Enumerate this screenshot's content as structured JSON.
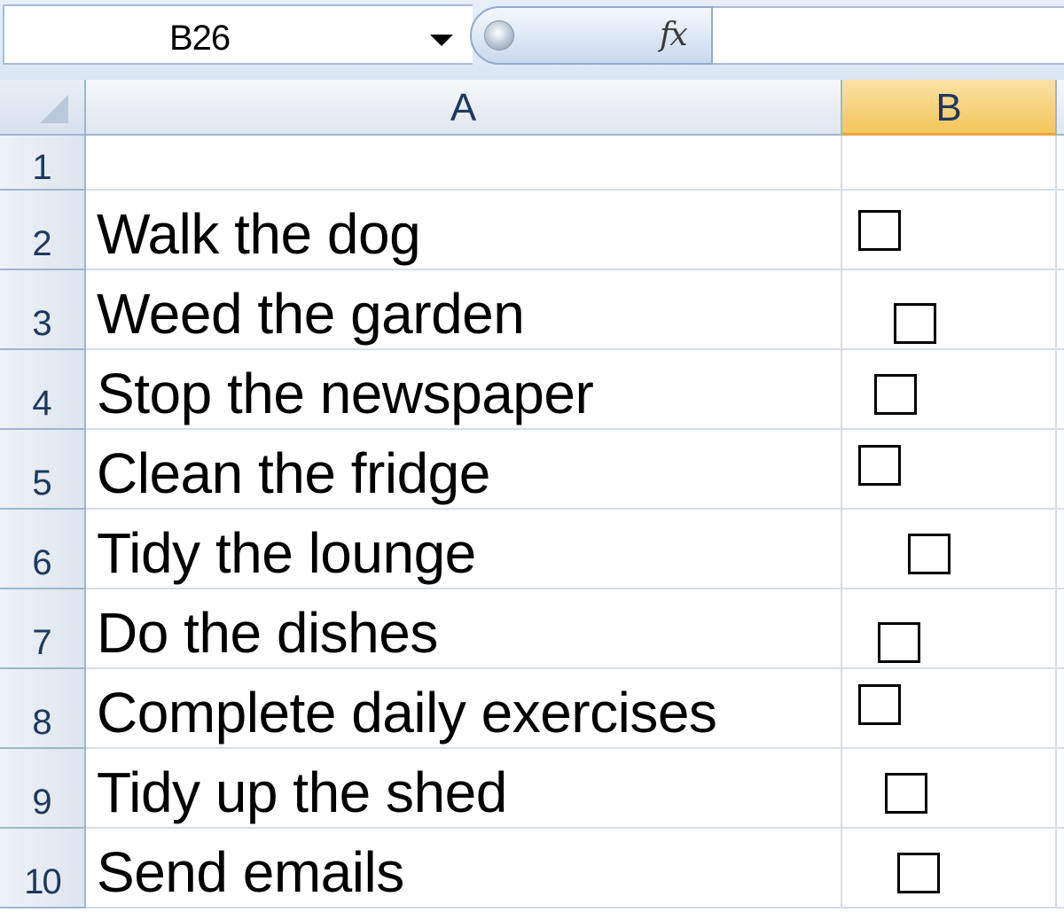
{
  "formula_bar": {
    "name_box_value": "B26",
    "fx_label": "fx",
    "formula_value": ""
  },
  "columns": [
    "A",
    "B"
  ],
  "rows": [
    {
      "number": "1",
      "task": "",
      "checked": false
    },
    {
      "number": "2",
      "task": "Walk the dog",
      "checked": false
    },
    {
      "number": "3",
      "task": "Weed the garden",
      "checked": false
    },
    {
      "number": "4",
      "task": "Stop the newspaper",
      "checked": false
    },
    {
      "number": "5",
      "task": "Clean the fridge",
      "checked": false
    },
    {
      "number": "6",
      "task": "Tidy the lounge",
      "checked": false
    },
    {
      "number": "7",
      "task": "Do the dishes",
      "checked": false
    },
    {
      "number": "8",
      "task": "Complete daily exercises",
      "checked": false
    },
    {
      "number": "9",
      "task": "Tidy up the shed",
      "checked": false
    },
    {
      "number": "10",
      "task": "Send emails",
      "checked": false
    }
  ],
  "colors": {
    "header_selected": "#f4c55c",
    "grid_line": "#d4dde8",
    "header_text": "#1e395b"
  }
}
